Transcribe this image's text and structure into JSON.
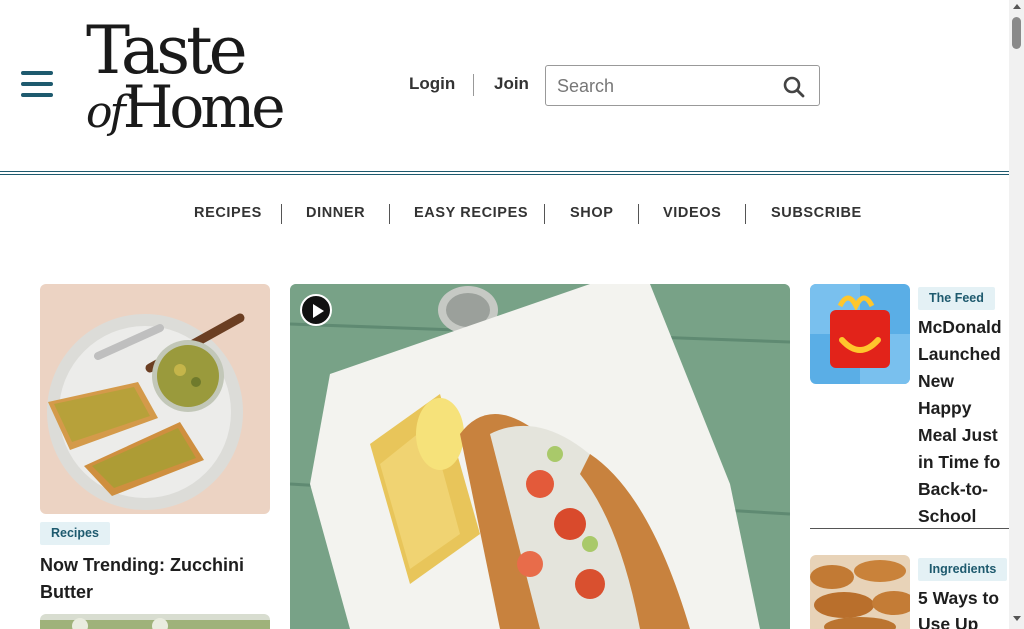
{
  "header": {
    "logo_line1": "Taste",
    "logo_of": "of",
    "logo_line2": "Home",
    "login_label": "Login",
    "join_label": "Join",
    "search_placeholder": "Search"
  },
  "nav": {
    "items": [
      "RECIPES",
      "DINNER",
      "EASY RECIPES",
      "SHOP",
      "VIDEOS",
      "SUBSCRIBE"
    ]
  },
  "left_card": {
    "tag": "Recipes",
    "title_line1": "Now Trending: Zucchini",
    "title_line2": "Butter"
  },
  "feed": [
    {
      "tag": "The Feed",
      "title_lines": [
        "McDonald",
        "Launched",
        "New",
        "Happy",
        "Meal Just",
        "in Time fo",
        "Back-to-",
        "School"
      ]
    },
    {
      "tag": "Ingredients",
      "title_lines": [
        "5 Ways to",
        "Use Up"
      ]
    }
  ],
  "colors": {
    "brand": "#1e5a6e",
    "tag_bg": "#e4f1f5",
    "happy_meal_red": "#e2231a",
    "happy_meal_yellow": "#ffc72c"
  },
  "icons": {
    "menu": "hamburger-icon",
    "search": "search-icon",
    "video": "play-icon"
  }
}
